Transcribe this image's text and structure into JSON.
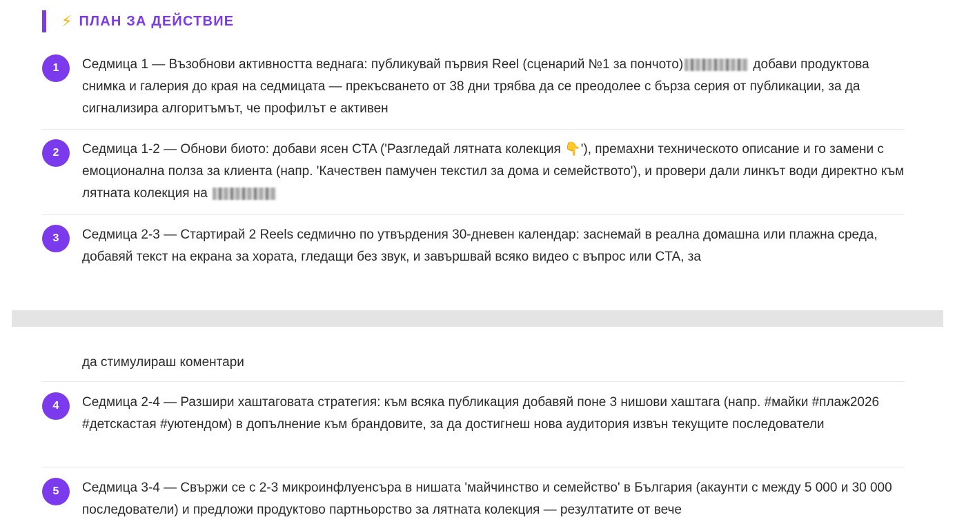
{
  "section": {
    "icon": "⚡",
    "title": "ПЛАН ЗА ДЕЙСТВИЕ"
  },
  "items": [
    {
      "number": "1",
      "text_a": "Седмица 1 — Възобнови активността веднага: публикувай първия Reel (сценарий №1 за пончото)",
      "text_b": " добави продуктова снимка и галерия до края на седмицата — прекъсването от 38 дни трябва да се преодолее с бърза серия от публикации, за да сигнализира алгоритъмът, че профилът е активен"
    },
    {
      "number": "2",
      "text_a": "Седмица 1-2 — Обнови биото: добави ясен CTA ('Разгледай лятната колекция ",
      "emoji": "👇",
      "text_b": "'), премахни техническото описание и го замени с емоционална полза за клиента (напр. 'Качествен памучен текстил за дома и семейството'), и провери дали линкът води директно към лятната колекция на "
    },
    {
      "number": "3",
      "text": "Седмица 2-3 — Стартирай 2 Reels седмично по утвърдения 30-дневен календар: заснемай в реална домашна или плажна среда, добавяй текст на екрана за хората, гледащи без звук, и завършвай всяко видео с въпрос или CTA, за",
      "continuation": "да стимулираш коментари"
    },
    {
      "number": "4",
      "text": "Седмица 2-4 — Разшири хаштаговата стратегия: към всяка публикация добавяй поне 3 нишови хаштага (напр. #майки #плаж2026 #детскастая #уютендом) в допълнение към брандовите, за да достигнеш нова аудитория извън текущите последователи"
    },
    {
      "number": "5",
      "text": "Седмица 3-4 — Свържи се с 2-3 микроинфлуенсъра в нишата 'майчинство и семейство' в България (акаунти с между 5 000 и 30 000 последователи) и предложи продуктово партньорство за лятната колекция — резултатите от вече"
    }
  ],
  "colors": {
    "accent": "#7c3aed",
    "bolt": "#f5b400",
    "text": "#2b2b2b",
    "divider": "#e7e7e7",
    "page_break": "#e4e4e4"
  }
}
